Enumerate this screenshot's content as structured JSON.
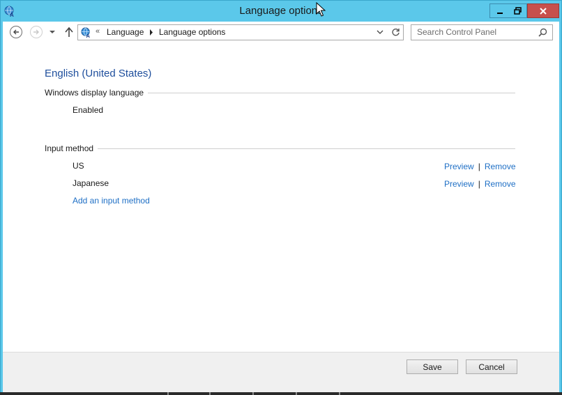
{
  "window": {
    "title": "Language options",
    "colors": {
      "titlebar": "#5bc8ea",
      "close": "#c7504c",
      "heading": "#1e4e9c",
      "link": "#1e6fc5"
    }
  },
  "nav": {
    "back_icon": "back-arrow-icon",
    "forward_icon": "forward-arrow-icon",
    "up_icon": "up-arrow-icon",
    "breadcrumb": {
      "overflow": "«",
      "items": [
        "Language",
        "Language options"
      ]
    },
    "search_placeholder": "Search Control Panel"
  },
  "main": {
    "language_name": "English (United States)",
    "display_section": {
      "title": "Windows display language",
      "status": "Enabled"
    },
    "input_section": {
      "title": "Input method",
      "methods": [
        {
          "name": "US",
          "preview": "Preview",
          "separator": "|",
          "remove": "Remove"
        },
        {
          "name": "Japanese",
          "preview": "Preview",
          "separator": "|",
          "remove": "Remove"
        }
      ],
      "add_link": "Add an input method"
    }
  },
  "footer": {
    "save_label": "Save",
    "cancel_label": "Cancel"
  }
}
